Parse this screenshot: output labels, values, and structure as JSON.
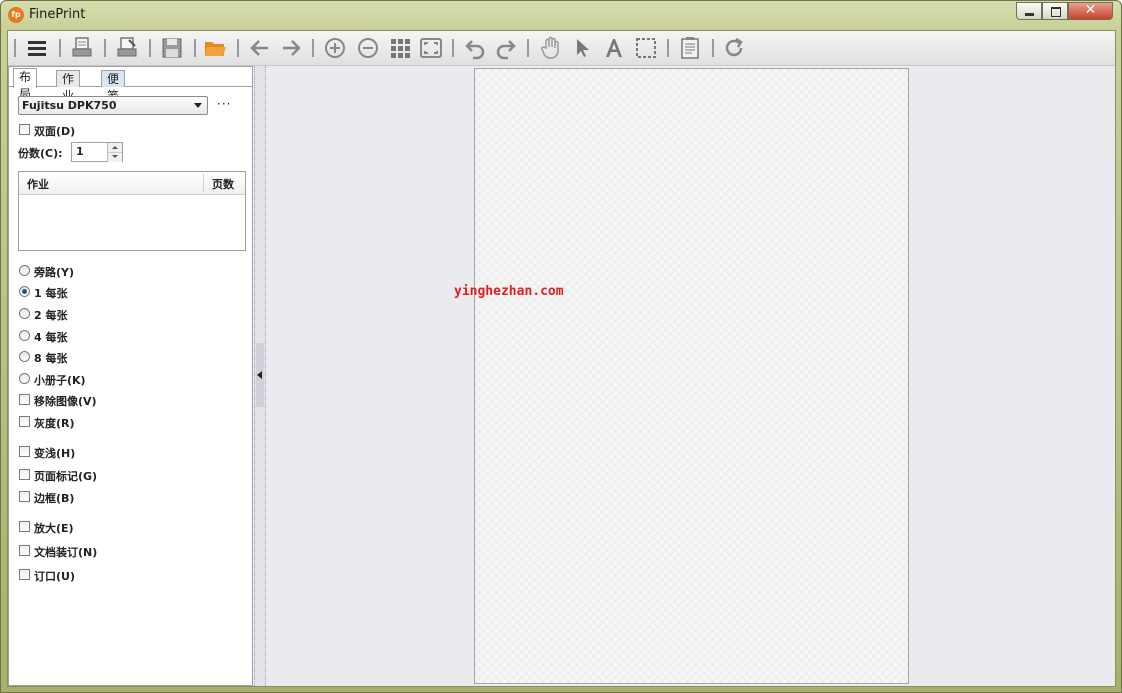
{
  "window": {
    "title": "FinePrint",
    "app_icon_text": "fp"
  },
  "toolbar": {
    "icons": [
      "menu-icon",
      "print-icon",
      "print-options-icon",
      "save-icon",
      "open-folder-icon",
      "back-arrow-icon",
      "forward-arrow-icon",
      "zoom-in-icon",
      "zoom-out-icon",
      "grid-view-icon",
      "fit-page-icon",
      "undo-icon",
      "redo-icon",
      "hand-icon",
      "pointer-icon",
      "text-icon",
      "select-rect-icon",
      "notes-icon",
      "refresh-icon"
    ]
  },
  "tabs": {
    "layout": "布局",
    "job": "作业",
    "notes": "便笺"
  },
  "printer": {
    "selected": "Fujitsu DPK750",
    "more": "···"
  },
  "duplex_label": "双面(D)",
  "copies": {
    "label": "份数(C):",
    "value": "1"
  },
  "jobs_table": {
    "col_job": "作业",
    "col_pages": "页数"
  },
  "layout_options": {
    "bypass": "旁路(Y)",
    "one_per_sheet": "1 每张",
    "two_per_sheet": "2 每张",
    "four_per_sheet": "4 每张",
    "eight_per_sheet": "8 每张",
    "booklet": "小册子(K)",
    "selected": "one_per_sheet"
  },
  "checkboxes": {
    "remove_images": "移除图像(V)",
    "grayscale": "灰度(R)",
    "lighten": "变浅(H)",
    "page_marks": "页面标记(G)",
    "border": "边框(B)",
    "enlarge": "放大(E)",
    "binding": "文档装订(N)",
    "gutter": "订口(U)"
  },
  "watermark": "yinghezhan.com",
  "colors": {
    "accent_orange": "#e97b1b",
    "watermark_red": "#e02020",
    "frame_olive": "#c9cf98"
  }
}
